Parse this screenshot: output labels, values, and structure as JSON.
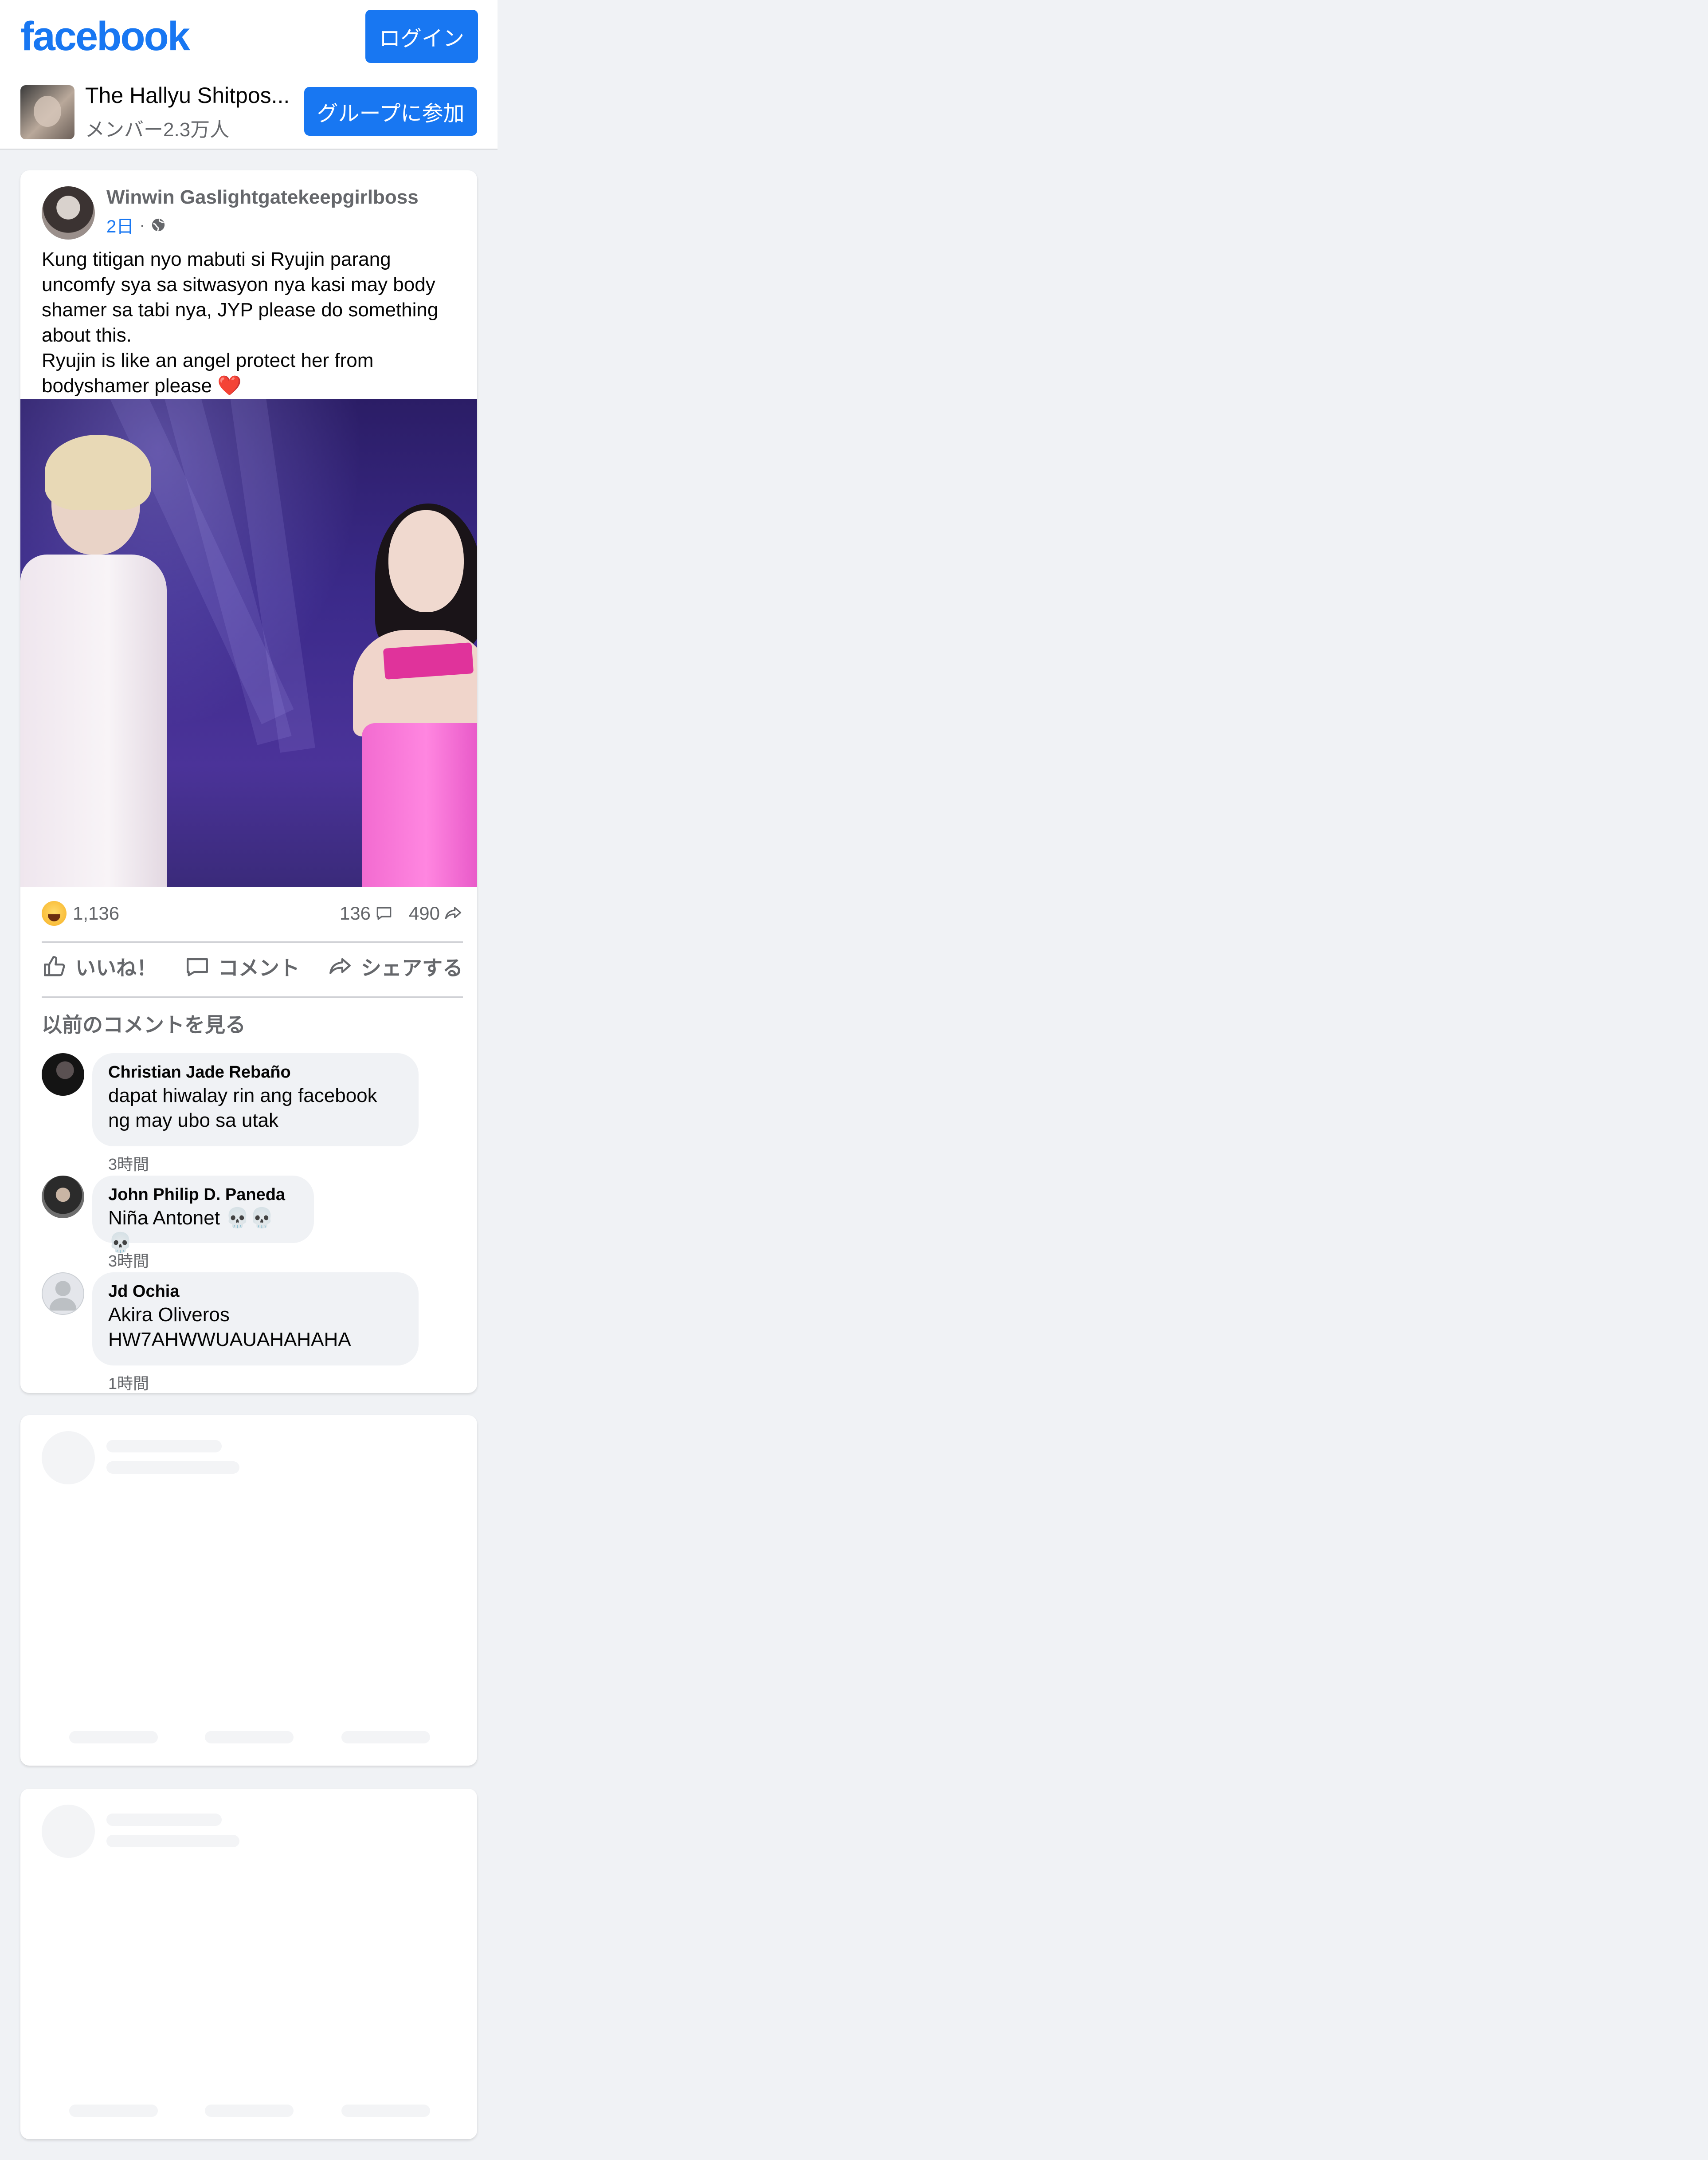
{
  "header": {
    "logo_text": "facebook",
    "login_label": "ログイン"
  },
  "group": {
    "name": "The Hallyu Shitpos...",
    "members": "メンバー2.3万人",
    "join_label": "グループに参加"
  },
  "post": {
    "author": "Winwin Gaslightgatekeepgirlboss",
    "time": "2日",
    "separator": "·",
    "text": "Kung titigan nyo mabuti si Ryujin parang uncomfy sya sa sitwasyon nya kasi may body shamer sa tabi nya, JYP please do something about this.\nRyujin is like an angel protect her from bodyshamer please ❤️",
    "reactions_count": "1,136",
    "comments_count": "136",
    "shares_count": "490",
    "actions": {
      "like": "いいね！",
      "comment": "コメント",
      "share": "シェアする"
    },
    "previous_comments_label": "以前のコメントを見る",
    "comments": [
      {
        "name": "Christian Jade Rebaño",
        "text": "dapat hiwalay rin ang facebook\nng may ubo sa utak",
        "time": "3時間"
      },
      {
        "name": "John Philip D. Paneda",
        "text": "Niña Antonet 💀💀💀",
        "time": "3時間"
      },
      {
        "name": "Jd Ochia",
        "text": "Akira Oliveros\nHW7AHWWUAUAHAHAHA",
        "time": "1時間"
      }
    ]
  },
  "colors": {
    "brand": "#1877f2",
    "background": "#f0f2f5",
    "secondary_text": "#65676b"
  }
}
